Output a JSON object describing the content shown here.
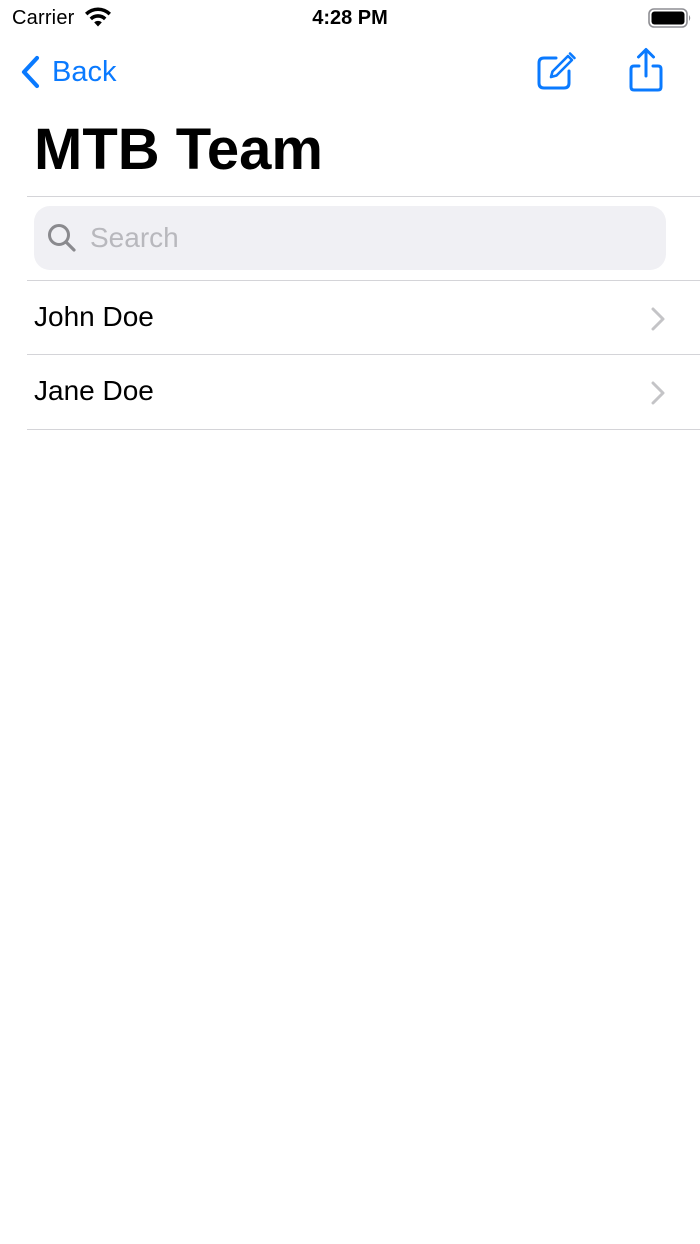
{
  "status_bar": {
    "carrier": "Carrier",
    "time": "4:28 PM",
    "icons": [
      "wifi-icon",
      "battery-icon"
    ]
  },
  "nav": {
    "back_label": "Back",
    "title": "MTB Team",
    "actions": [
      "compose-icon",
      "share-icon"
    ]
  },
  "search": {
    "value": "",
    "placeholder": "Search"
  },
  "team_members": [
    {
      "name": "John Doe"
    },
    {
      "name": "Jane Doe"
    }
  ],
  "colors": {
    "accent": "#0A7AFF",
    "search_bg": "#F0F0F4",
    "separator": "#D4D4D8",
    "chevron": "#C4C4C7",
    "placeholder": "#B8B8BD"
  }
}
